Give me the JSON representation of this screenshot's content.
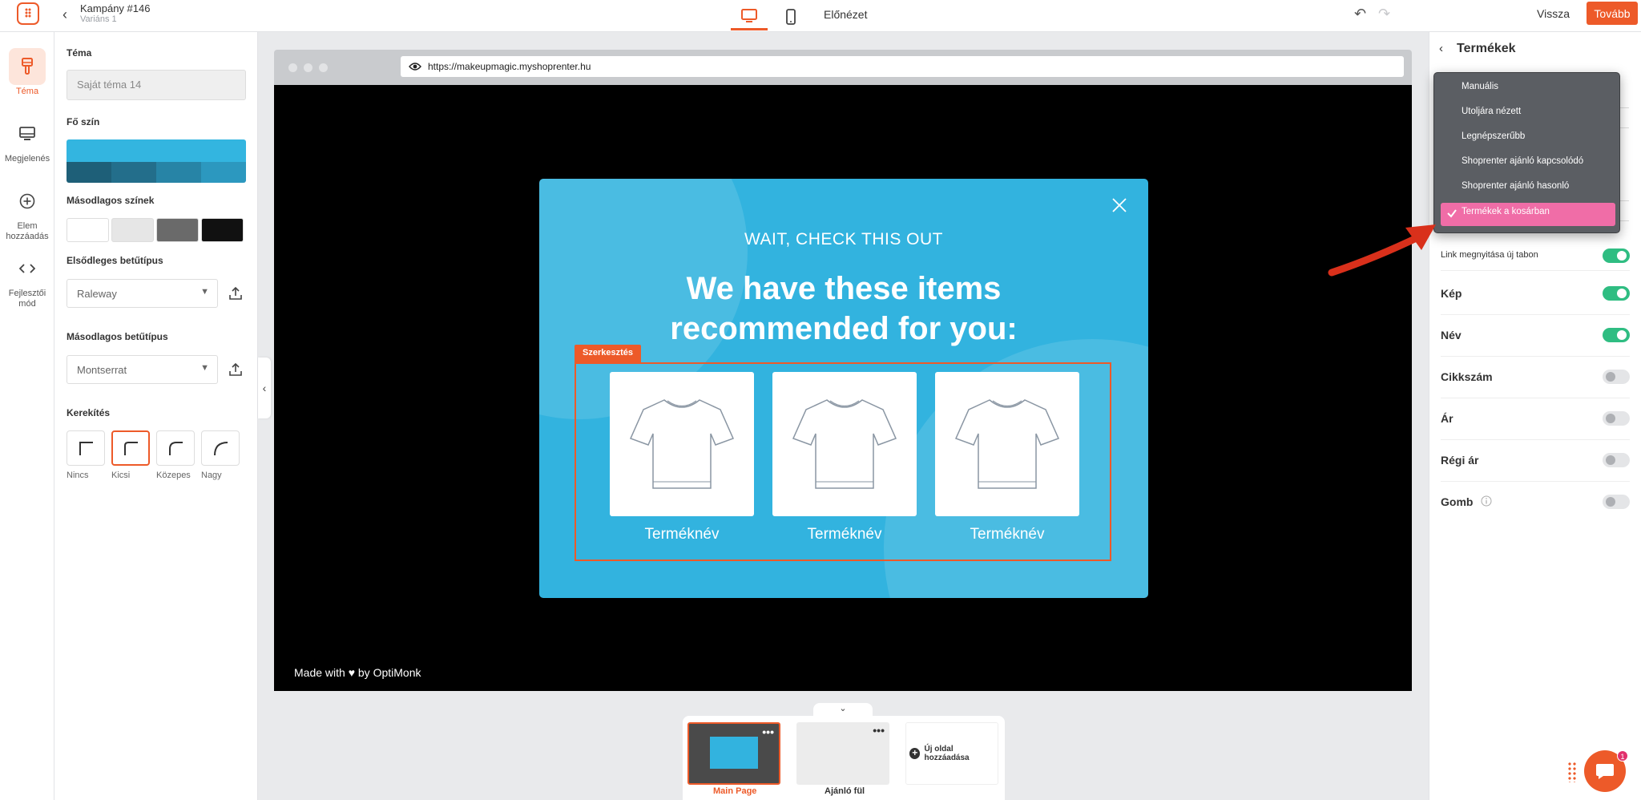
{
  "header": {
    "campaign_title": "Kampány #146",
    "variant": "Variáns 1",
    "preview_label": "Előnézet",
    "back_label": "Vissza",
    "next_label": "Tovább"
  },
  "iconbar": {
    "items": [
      {
        "label": "Téma",
        "icon": "brush-icon",
        "active": true
      },
      {
        "label": "Megjelenés",
        "icon": "monitor-icon"
      },
      {
        "label": "Elem hozzáadás",
        "icon": "plus-circle-icon"
      },
      {
        "label": "Fejlesztői mód",
        "icon": "code-icon"
      }
    ]
  },
  "theme_panel": {
    "theme_label": "Téma",
    "theme_value": "Saját téma 14",
    "main_color_label": "Fő szín",
    "main_color": "#33b5e0",
    "main_shades": [
      "#1e5f78",
      "#236e8b",
      "#2784a6",
      "#2c98bf"
    ],
    "secondary_colors_label": "Másodlagos színek",
    "secondary_colors": [
      "#ffffff",
      "#e6e6e6",
      "#6a6a6a",
      "#111111"
    ],
    "primary_font_label": "Elsődleges betűtípus",
    "primary_font": "Raleway",
    "secondary_font_label": "Másodlagos betűtípus",
    "secondary_font": "Montserrat",
    "rounding_label": "Kerekítés",
    "rounding_options": [
      "Nincs",
      "Kicsi",
      "Közepes",
      "Nagy"
    ],
    "rounding_selected": "Kicsi"
  },
  "browser": {
    "url": "https://makeupmagic.myshoprenter.hu",
    "made_with": "Made with ♥ by OptiMonk"
  },
  "popup": {
    "pretitle": "WAIT, CHECK THIS OUT",
    "headline_line1": "We have these items",
    "headline_line2": "recommended for you:",
    "edit_tag": "Szerkesztés",
    "products": [
      "Terméknév",
      "Terméknév",
      "Terméknév"
    ],
    "background_color": "#32b3df"
  },
  "pages": {
    "items": [
      {
        "label": "Main Page",
        "active": true
      },
      {
        "label": "Ajánló fül"
      }
    ],
    "add_label": "Új oldal hozzáadása"
  },
  "right_panel": {
    "title": "Termékek",
    "dropdown_options": [
      "Manuális",
      "Utoljára nézett",
      "Legnépszerűbb",
      "Shoprenter ajánló kapcsolódó",
      "Shoprenter ajánló hasonló",
      "Termékek a kosárban"
    ],
    "dropdown_selected": "Termékek a kosárban",
    "toggles": [
      {
        "label": "Link megnyitása új tabon",
        "on": true
      },
      {
        "label": "Kép",
        "on": true
      },
      {
        "label": "Név",
        "on": true
      },
      {
        "label": "Cikkszám",
        "on": false
      },
      {
        "label": "Ár",
        "on": false
      },
      {
        "label": "Régi ár",
        "on": false
      },
      {
        "label": "Gomb",
        "on": false
      }
    ]
  },
  "chat": {
    "badge": "1"
  },
  "colors": {
    "accent": "#ed5a29",
    "toggle_on": "#2fbd82",
    "dropdown_selected": "#f06da7"
  }
}
